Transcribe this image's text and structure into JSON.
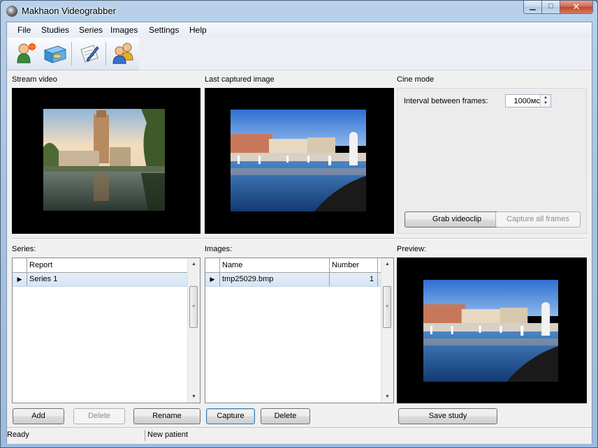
{
  "window": {
    "title": "Makhaon Videograbber"
  },
  "menu": [
    "File",
    "Studies",
    "Series",
    "Images",
    "Settings",
    "Help"
  ],
  "toolbar": {
    "buttons": [
      {
        "icon": "new-patient-icon"
      },
      {
        "icon": "open-studies-box-icon"
      },
      {
        "icon": "edit-document-icon"
      },
      {
        "icon": "users-icon"
      }
    ]
  },
  "panels": {
    "stream_video_label": "Stream video",
    "last_captured_label": "Last captured image",
    "cine_mode_label": "Cine mode",
    "series_label": "Series:",
    "images_label": "Images:",
    "preview_label": "Preview:"
  },
  "cine": {
    "interval_label": "Interval between frames:",
    "interval_value": "1000мс",
    "grab_videoclip": "Grab videoclip",
    "capture_all_frames": "Capture all frames"
  },
  "series_grid": {
    "columns": [
      "Report"
    ],
    "rows": [
      {
        "report": "Series 1"
      }
    ]
  },
  "images_grid": {
    "columns": [
      "Name",
      "Number"
    ],
    "rows": [
      {
        "name": "tmp25029.bmp",
        "number": "1"
      }
    ]
  },
  "series_buttons": {
    "add": "Add",
    "delete": "Delete",
    "rename": "Rename"
  },
  "images_buttons": {
    "capture": "Capture",
    "delete": "Delete"
  },
  "preview_buttons": {
    "save_study": "Save study"
  },
  "status": {
    "left": "Ready",
    "right": "New patient"
  }
}
